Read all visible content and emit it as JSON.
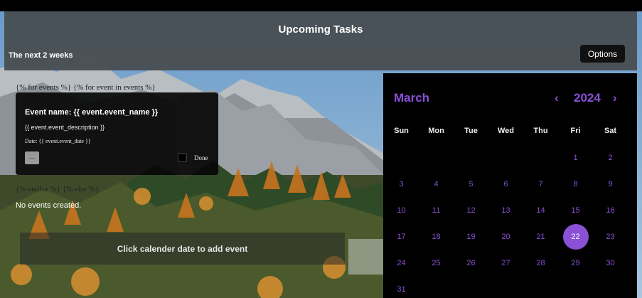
{
  "header": {
    "title": "Upcoming Tasks",
    "subtitle": "The next 2 weeks",
    "options_label": "Options"
  },
  "template": {
    "for_line": "{% for events %} {% for event in events %}",
    "endfor_line": "{% endfor %} {% else %}"
  },
  "event": {
    "name": "Event name: {{ event.event_name }}",
    "description": "{{ event.event_description }}",
    "date": "Date: {{ event.event_date }}",
    "more_label": "...",
    "done_label": "Done"
  },
  "empty_message": "No events created.",
  "add_hint": "Click calender date to add event",
  "calendar": {
    "month": "March",
    "year": "2024",
    "prev": "‹",
    "next": "›",
    "weekdays": [
      "Sun",
      "Mon",
      "Tue",
      "Wed",
      "Thu",
      "Fri",
      "Sat"
    ],
    "leading_blanks": 5,
    "days": [
      "1",
      "2",
      "3",
      "4",
      "5",
      "6",
      "7",
      "8",
      "9",
      "10",
      "11",
      "12",
      "13",
      "14",
      "15",
      "16",
      "17",
      "18",
      "19",
      "20",
      "21",
      "22",
      "23",
      "24",
      "25",
      "26",
      "27",
      "28",
      "29",
      "30",
      "31"
    ],
    "today": "22",
    "accent_color": "#8a50d6"
  }
}
